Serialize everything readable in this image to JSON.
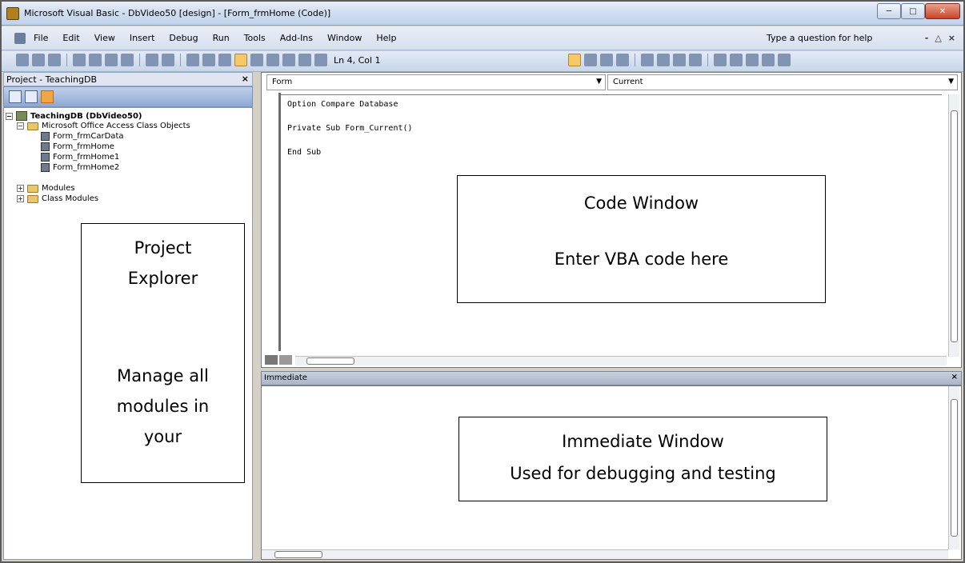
{
  "window": {
    "title": "Microsoft Visual Basic - DbVideo50 [design] - [Form_frmHome (Code)]",
    "controls": [
      "─",
      "□",
      "✕"
    ]
  },
  "menubar": {
    "items": [
      {
        "label": "File"
      },
      {
        "label": "Edit"
      },
      {
        "label": "View"
      },
      {
        "label": "Insert"
      },
      {
        "label": "Debug"
      },
      {
        "label": "Run"
      },
      {
        "label": "Tools"
      },
      {
        "label": "Add-Ins"
      },
      {
        "label": "Window"
      },
      {
        "label": "Help"
      }
    ],
    "help_placeholder": "Type a question for help",
    "mdi_controls": [
      "-",
      "△",
      "×"
    ]
  },
  "toolbar": {
    "cursor_position": "Ln 4, Col 1"
  },
  "project": {
    "title": "Project - TeachingDB",
    "close": "×",
    "tree": {
      "root": "TeachingDB (DbVideo50)",
      "class_objects_folder": "Microsoft Office Access Class Objects",
      "forms": [
        "Form_frmCarData",
        "Form_frmHome",
        "Form_frmHome1",
        "Form_frmHome2"
      ],
      "modules_folder": "Modules",
      "class_modules_folder": "Class Modules"
    },
    "callout": {
      "line1": "Project",
      "line2": "Explorer",
      "line3": "Manage all",
      "line4": "modules in",
      "line5": "your"
    }
  },
  "code_window": {
    "object_combo": "Form",
    "procedure_combo": "Current",
    "lines": [
      "Option Compare Database",
      "Private Sub Form_Current()",
      "End Sub"
    ],
    "callout": {
      "title": "Code Window",
      "subtitle": "Enter VBA code here"
    }
  },
  "immediate_window": {
    "title": "Immediate",
    "close": "×",
    "callout": {
      "title": "Immediate Window",
      "subtitle": "Used for debugging and testing"
    }
  },
  "colors": {
    "titlebar": "#d3e0f2",
    "panel_bg": "#d4d0c8",
    "highlight": "#f2a541"
  }
}
